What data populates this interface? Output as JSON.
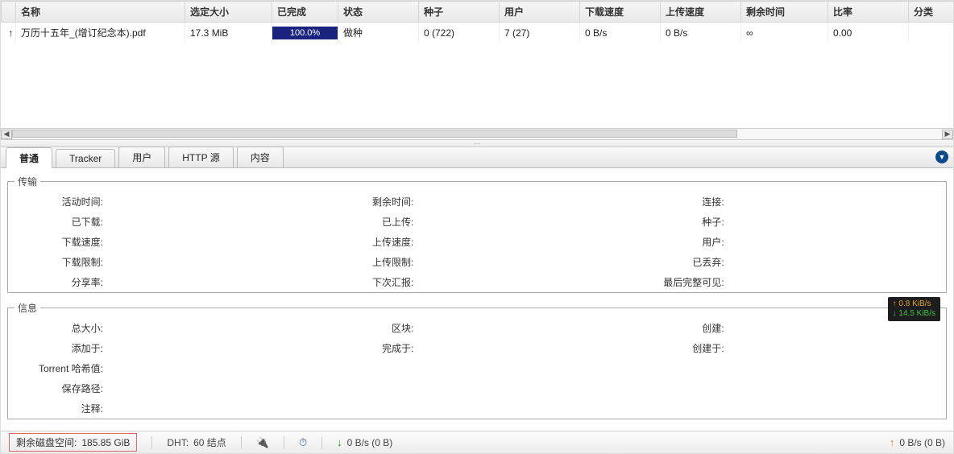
{
  "columns": {
    "name": "名称",
    "size": "选定大小",
    "done": "已完成",
    "status": "状态",
    "seeds": "种子",
    "peers": "用户",
    "dlspeed": "下载速度",
    "ulspeed": "上传速度",
    "eta": "剩余时间",
    "ratio": "比率",
    "category": "分类"
  },
  "row": {
    "icon": "↑",
    "name": "万历十五年_(增订纪念本).pdf",
    "size": "17.3 MiB",
    "done": "100.0%",
    "status": "做种",
    "seeds": "0 (722)",
    "peers": "7 (27)",
    "dlspeed": "0 B/s",
    "ulspeed": "0 B/s",
    "eta": "∞",
    "ratio": "0.00",
    "category": ""
  },
  "tabs": {
    "general": "普通",
    "tracker": "Tracker",
    "peers": "用户",
    "http": "HTTP 源",
    "content": "内容"
  },
  "transfer_legend": "传输",
  "info_legend": "信息",
  "labels": {
    "active": "活动时间",
    "eta": "剩余时间",
    "conn": "连接",
    "downloaded": "已下载",
    "uploaded": "已上传",
    "seeds": "种子",
    "dlspeed": "下载速度",
    "ulspeed": "上传速度",
    "peers": "用户",
    "dllimit": "下载限制",
    "ullimit": "上传限制",
    "wasted": "已丢弃",
    "share": "分享率",
    "reannounce": "下次汇报",
    "lastseen": "最后完整可见",
    "totalsize": "总大小",
    "pieces": "区块",
    "created": "创建",
    "addedon": "添加于",
    "completedon": "完成于",
    "createdby": "创建于",
    "hash": "Torrent 哈希值",
    "savepath": "保存路径",
    "comment": "注释"
  },
  "badge": {
    "up": "↑ 0.8 KiB/s",
    "down": "↓ 14.5 KiB/s"
  },
  "status": {
    "disk_label": "剩余磁盘空间:",
    "disk_value": "185.85 GiB",
    "dht_label": "DHT:",
    "dht_value": "60 结点",
    "dl": "0 B/s (0 B)",
    "ul": "0 B/s (0 B)"
  }
}
